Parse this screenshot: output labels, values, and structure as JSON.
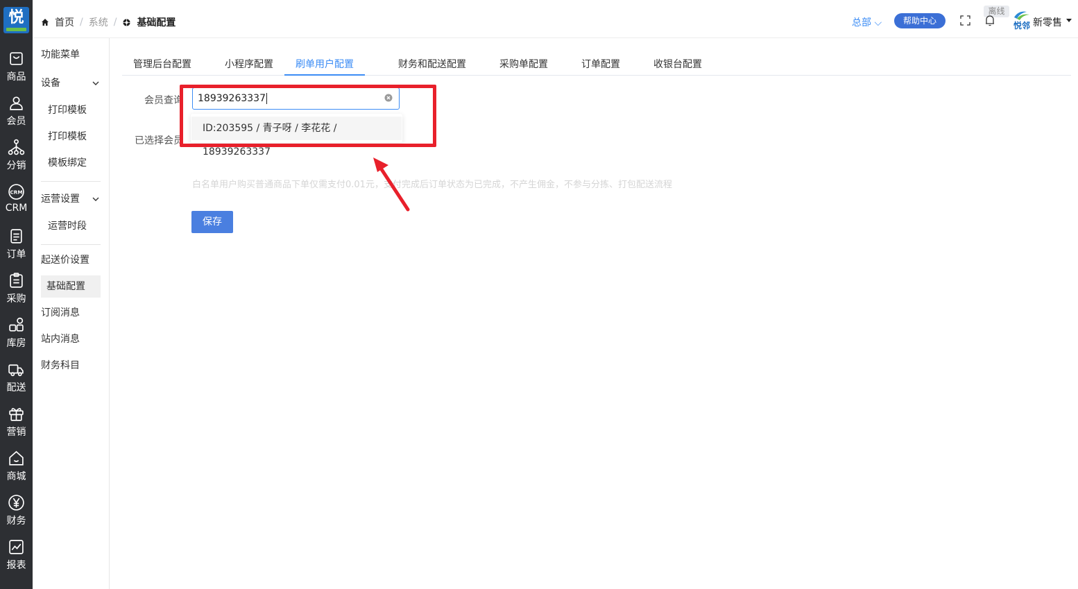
{
  "rail": {
    "logo": "悦",
    "items": [
      {
        "label": "商品",
        "icon": "bag-icon"
      },
      {
        "label": "会员",
        "icon": "user-icon"
      },
      {
        "label": "分销",
        "icon": "network-icon"
      },
      {
        "label": "CRM",
        "icon": "crm-icon"
      },
      {
        "label": "订单",
        "icon": "document-icon"
      },
      {
        "label": "采购",
        "icon": "clipboard-icon"
      },
      {
        "label": "库房",
        "icon": "grid-icon"
      },
      {
        "label": "配送",
        "icon": "truck-icon"
      },
      {
        "label": "营销",
        "icon": "gift-icon"
      },
      {
        "label": "商城",
        "icon": "house-icon"
      },
      {
        "label": "财务",
        "icon": "yen-icon"
      },
      {
        "label": "报表",
        "icon": "chart-icon"
      }
    ]
  },
  "header": {
    "breadcrumb": {
      "home": "首页",
      "section": "系统",
      "current": "基础配置"
    },
    "hq": "总部 ⌵",
    "help": "帮助中心",
    "offline": "离线",
    "brand_logo_text": "悦邻",
    "brand_name": "新零售"
  },
  "submenu": {
    "title": "功能菜单",
    "device_group": "设备",
    "device_items": [
      "打印模板",
      "打印模板",
      "模板绑定"
    ],
    "ops_group": "运营设置",
    "ops_items": [
      "运营时段"
    ],
    "items": [
      "起送价设置",
      "基础配置",
      "订阅消息",
      "站内消息",
      "财务科目"
    ]
  },
  "tabs": [
    "管理后台配置",
    "小程序配置",
    "刷单用户配置",
    "财务和配送配置",
    "采购单配置",
    "订单配置",
    "收银台配置"
  ],
  "form": {
    "member_query_label": "会员查询",
    "selected_label": "已选择会员",
    "search_value": "18939263337",
    "option": "ID:203595 / 青子呀 / 李花花 / 18939263337",
    "note": "白名单用户购买普通商品下单仅需支付0.01元，支付完成后订单状态为已完成，不产生佣金，不参与分拣、打包配送流程",
    "save": "保存"
  }
}
